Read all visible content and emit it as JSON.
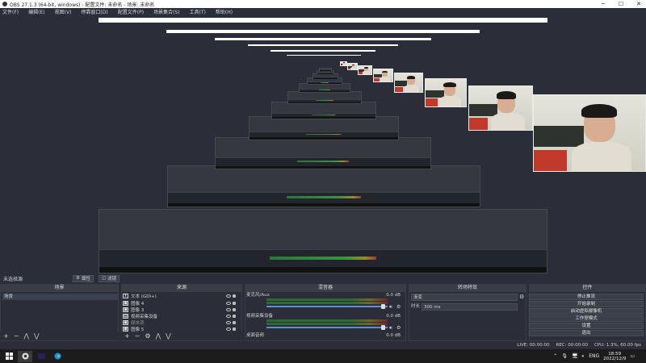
{
  "window": {
    "title": "OBS 27.1.3 (64-bit, windows) - 配置文件: 未命名 - 场景: 未命名"
  },
  "menu": [
    "文件(F)",
    "编辑(E)",
    "视图(V)",
    "停靠窗口(D)",
    "配置文件(P)",
    "场景集合(S)",
    "工具(T)",
    "帮助(H)"
  ],
  "scene_bar": {
    "current": "未选择源",
    "props": "属性",
    "filters": "滤镜"
  },
  "docks": {
    "scenes": "场景",
    "sources": "来源",
    "mixer": "混音器",
    "transitions": "转场特效",
    "controls": "控件"
  },
  "scenes": [
    "场景"
  ],
  "sources": [
    {
      "icon": "T",
      "name": "文本 (GDI+)"
    },
    {
      "icon": "▣",
      "name": "图像 4"
    },
    {
      "icon": "▣",
      "name": "图像 3"
    },
    {
      "icon": "▤",
      "name": "视频采集设备"
    },
    {
      "icon": "▣",
      "name": "媒体源"
    },
    {
      "icon": "▣",
      "name": "图像 5"
    }
  ],
  "mixer": [
    {
      "name": "麦克风/Aux",
      "db": "0.0 dB"
    },
    {
      "name": "视频采集设备",
      "db": "0.0 dB"
    },
    {
      "name": "桌面音频",
      "db": "0.0 dB"
    }
  ],
  "transitions": {
    "type": "渐变",
    "duration_label": "时长",
    "duration": "300 ms"
  },
  "controls": [
    "停止推流",
    "开始录制",
    "启动虚拟摄像机",
    "工作室模式",
    "设置",
    "退出"
  ],
  "status": {
    "live": "LIVE: 00:00:00",
    "rec": "REC: 00:00:00",
    "cpu": "CPU: 1.3%, 60.00 fps"
  },
  "taskbar": {
    "time": "18:59",
    "date": "2022/12/9",
    "lang": "ENG"
  }
}
